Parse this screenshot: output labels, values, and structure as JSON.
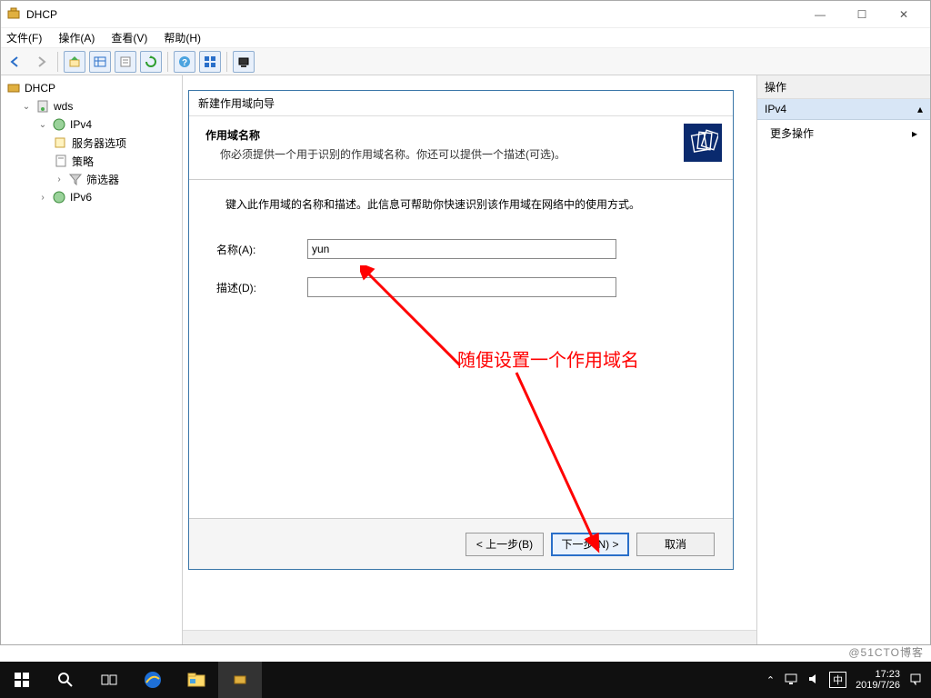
{
  "window": {
    "title": "DHCP",
    "minimize": "—",
    "maximize": "☐",
    "close": "✕"
  },
  "menu": {
    "file": "文件(F)",
    "action": "操作(A)",
    "view": "查看(V)",
    "help": "帮助(H)"
  },
  "tree": {
    "root": "DHCP",
    "server": "wds",
    "ipv4": "IPv4",
    "server_options": "服务器选项",
    "policies": "策略",
    "filters": "筛选器",
    "ipv6": "IPv6"
  },
  "actions_pane": {
    "header": "操作",
    "section": "IPv4",
    "more": "更多操作"
  },
  "dialog": {
    "title": "新建作用域向导",
    "header_title": "作用域名称",
    "header_sub": "你必须提供一个用于识别的作用域名称。你还可以提供一个描述(可选)。",
    "body_hint": "键入此作用域的名称和描述。此信息可帮助你快速识别该作用域在网络中的使用方式。",
    "name_label": "名称(A):",
    "name_value": "yun",
    "desc_label": "描述(D):",
    "desc_value": "",
    "back": "< 上一步(B)",
    "next": "下一步(N) >",
    "cancel": "取消"
  },
  "annotation": {
    "text1": "随便设置一个作用域名"
  },
  "taskbar": {
    "time": "17:23",
    "date": "2019/7/26",
    "ime": "中"
  },
  "watermark": "@51CTO博客"
}
